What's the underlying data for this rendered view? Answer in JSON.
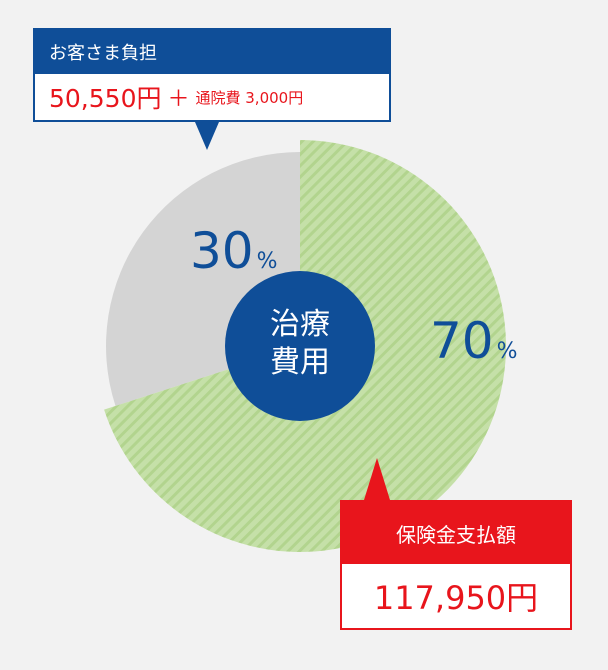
{
  "customer_callout": {
    "title": "お客さま負担",
    "amount": "50,550円",
    "plus": "＋",
    "note": "通院費 3,000円"
  },
  "insurance_callout": {
    "title": "保険金支払額",
    "amount": "117,950円"
  },
  "center_label": [
    "治療",
    "費用"
  ],
  "colors": {
    "customer": "#d4d4d4",
    "insurance": "#c5e0a8",
    "insurance_stripe": "#b2d48e",
    "center": "#0f4e98",
    "percent_text": "#0f4e98",
    "customer_accent": "#0f4e98",
    "insurance_accent": "#e8151c"
  },
  "chart_data": {
    "type": "pie",
    "categories": [
      "お客さま負担",
      "保険金支払額"
    ],
    "values": [
      30,
      70
    ],
    "labels": [
      "30",
      "70"
    ],
    "unit": "%"
  }
}
